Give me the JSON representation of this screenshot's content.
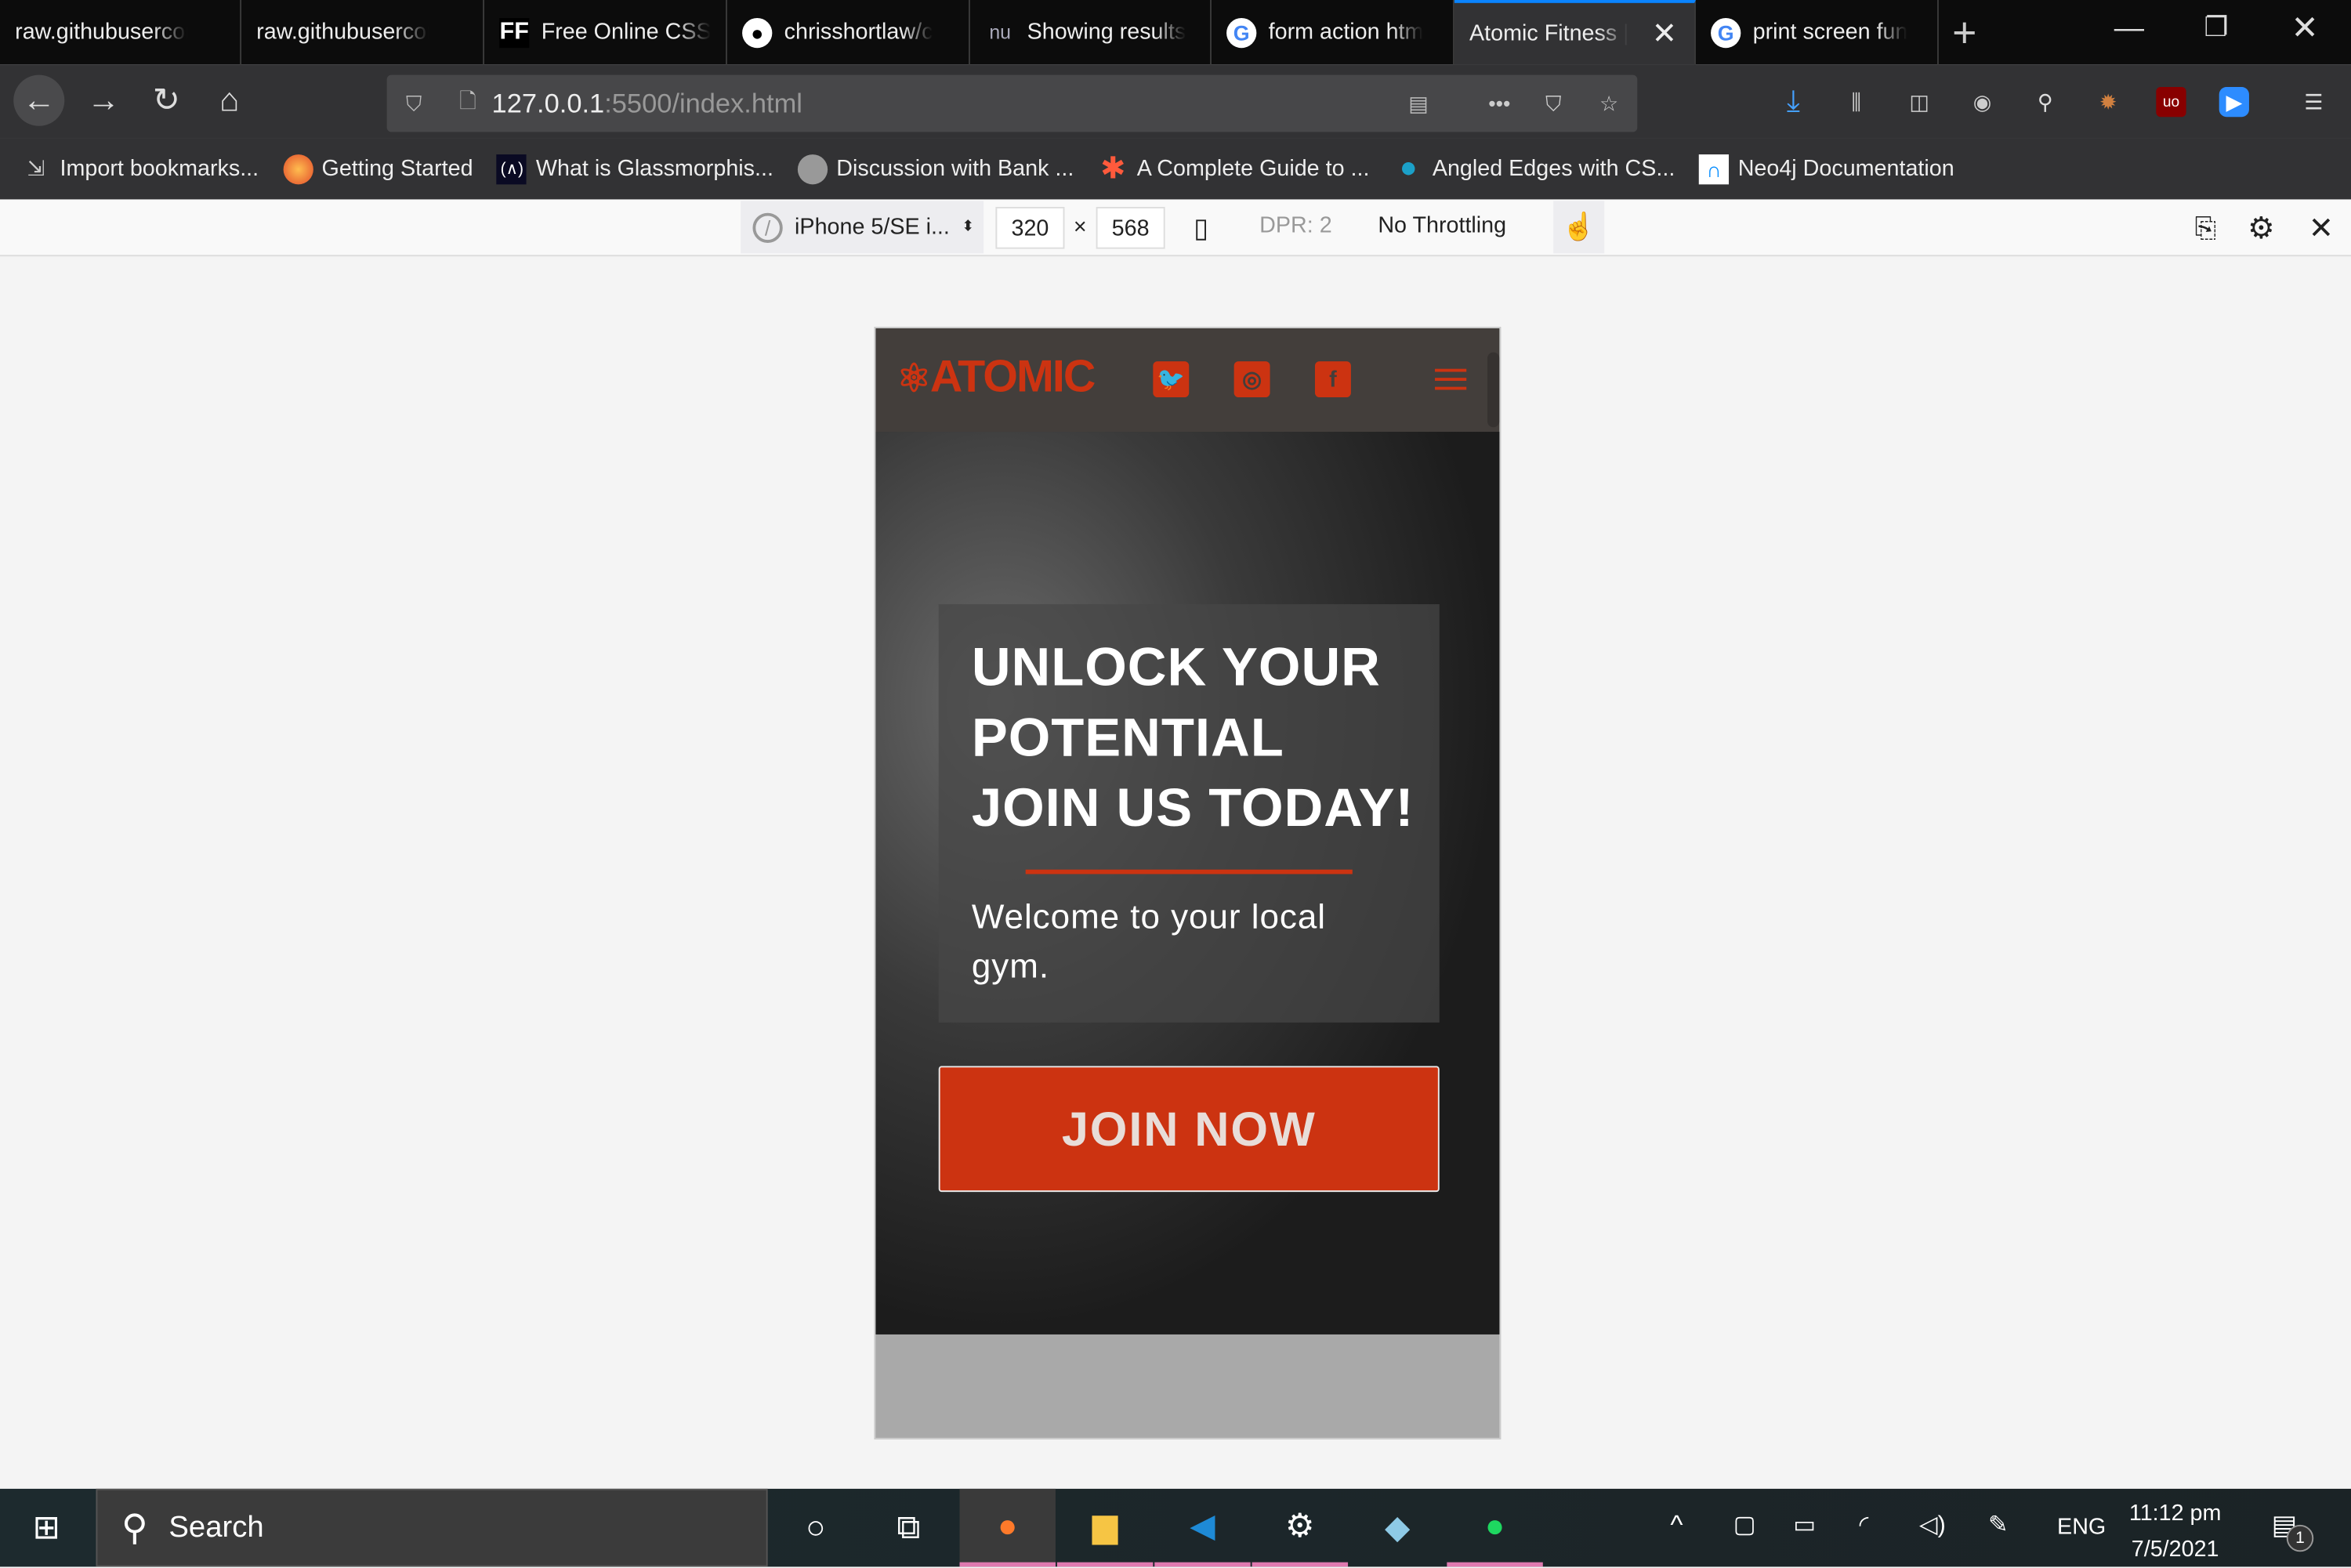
{
  "browser": {
    "tabs": [
      {
        "title": "raw.githubusercontent",
        "icon": "none"
      },
      {
        "title": "raw.githubusercontent",
        "icon": "none"
      },
      {
        "title": "Free Online CSS",
        "icon": "ff-icon"
      },
      {
        "title": "chrisshortlaw/c",
        "icon": "github-icon"
      },
      {
        "title": "Showing results",
        "icon": "nu-icon"
      },
      {
        "title": "form action htm",
        "icon": "google-icon"
      },
      {
        "title": "Atomic Fitness |",
        "icon": "none",
        "active": true
      },
      {
        "title": "print screen fun",
        "icon": "google-icon"
      }
    ],
    "url_host": "127.0.0.1",
    "url_rest": ":5500/index.html",
    "bookmarks": [
      "Import bookmarks...",
      "Getting Started",
      "What is Glassmorphis...",
      "Discussion with Bank ...",
      "A Complete Guide to ...",
      "Angled Edges with CS...",
      "Neo4j Documentation"
    ],
    "accent": "#0a84ff"
  },
  "rdm": {
    "device": "iPhone 5/SE i...",
    "width": "320",
    "times": "×",
    "height": "568",
    "dpr": "DPR: 2",
    "throttling": "No Throttling"
  },
  "site": {
    "logo": "ATOMIC",
    "heading": [
      "UNLOCK YOUR",
      "POTENTIAL",
      "JOIN US TODAY!"
    ],
    "welcome": "Welcome to your local gym.",
    "cta": "JOIN NOW",
    "brand_color": "#cc3311"
  },
  "taskbar": {
    "search": "Search",
    "lang": "ENG",
    "time": "11:12 pm",
    "date": "7/5/2021",
    "notifications": "1"
  }
}
